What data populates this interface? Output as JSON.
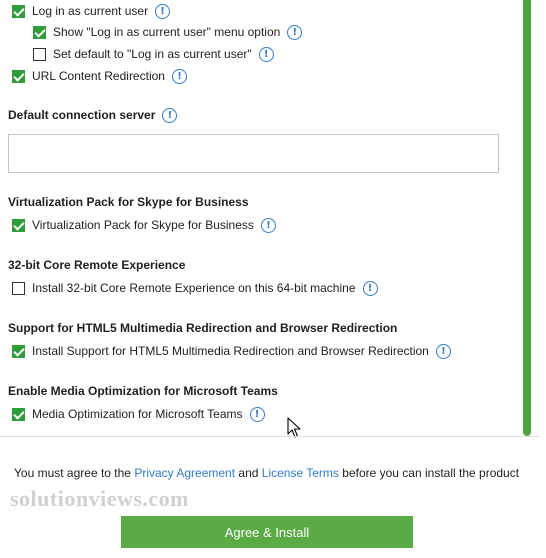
{
  "options": {
    "login_current_user": {
      "label": "Log in as current user",
      "checked": true
    },
    "show_menu_option": {
      "label": "Show \"Log in as current user\" menu option",
      "checked": true
    },
    "set_default": {
      "label": "Set default to \"Log in as current user\"",
      "checked": false
    },
    "url_redirection": {
      "label": "URL Content Redirection",
      "checked": true
    }
  },
  "default_connection": {
    "title": "Default connection server",
    "value": ""
  },
  "skype": {
    "title": "Virtualization Pack for Skype for Business",
    "option_label": "Virtualization Pack for Skype for Business",
    "checked": true
  },
  "core_remote": {
    "title": "32-bit Core Remote Experience",
    "option_label": "Install 32-bit Core Remote Experience on this 64-bit machine",
    "checked": false
  },
  "html5": {
    "title": "Support for HTML5 Multimedia Redirection and Browser Redirection",
    "option_label": "Install Support for HTML5 Multimedia Redirection and Browser Redirection",
    "checked": true
  },
  "teams": {
    "title": "Enable Media Optimization for Microsoft Teams",
    "option_label": "Media Optimization for Microsoft Teams",
    "checked": true
  },
  "footer": {
    "prefix": "You must agree to the",
    "privacy_link": "Privacy Agreement",
    "and": "and",
    "license_link": "License Terms",
    "suffix": "before you can install the product",
    "button_label": "Agree & Install"
  },
  "watermark": "solutionviews.com",
  "info_glyph": "!",
  "colors": {
    "accent_green": "#5aaa46",
    "checkbox_green": "#2e9e3a",
    "link_blue": "#2e7bd1",
    "scrollbar_green": "#4ea53b"
  },
  "icons": {
    "info": "info-circle-icon",
    "checkbox": "checkbox-icon",
    "cursor": "mouse-pointer-icon"
  }
}
